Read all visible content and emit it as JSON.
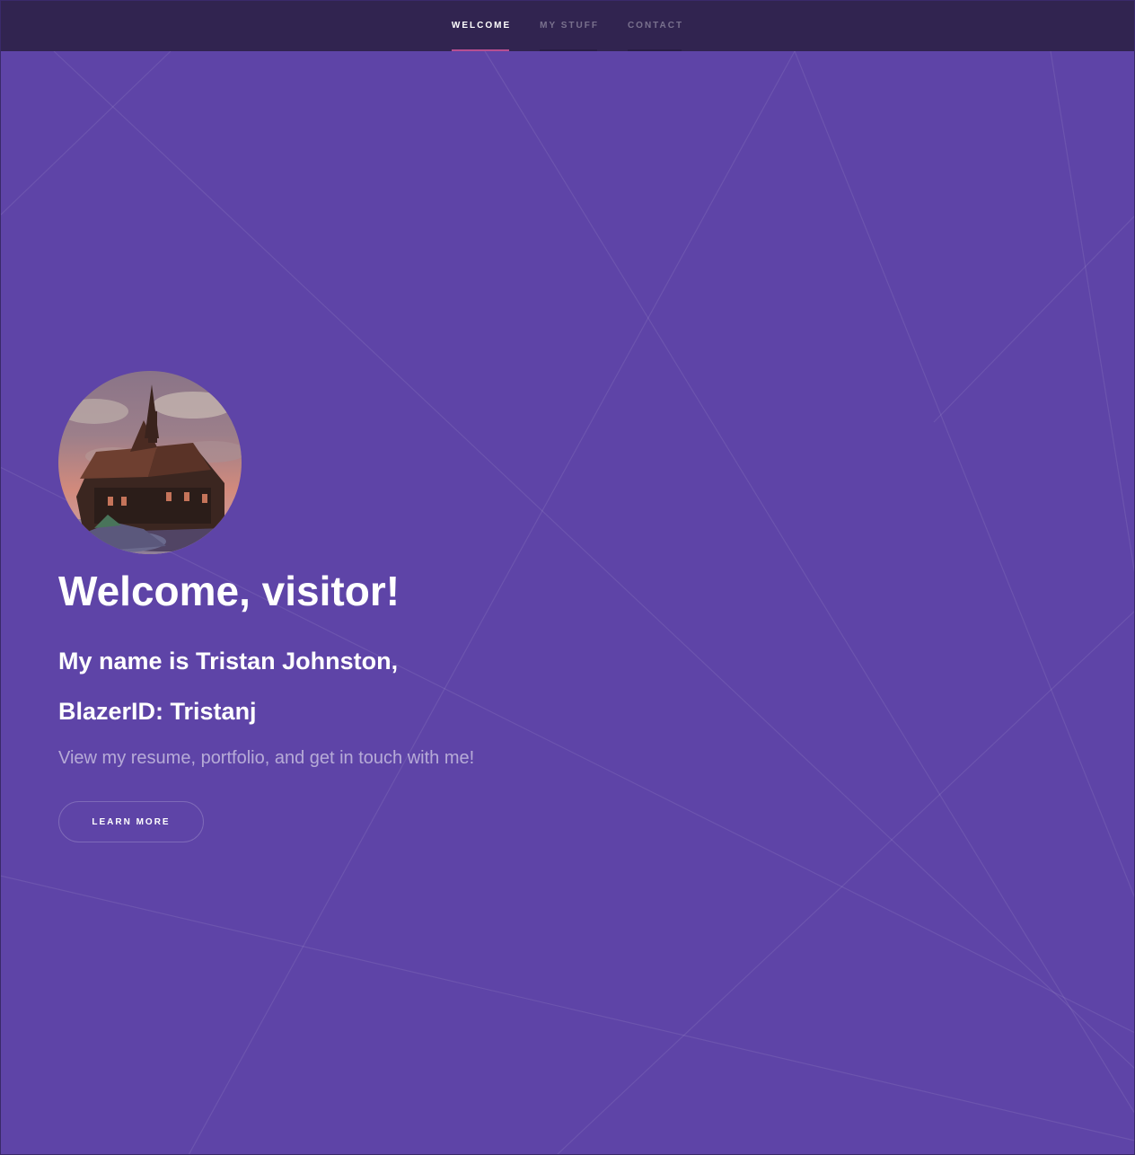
{
  "nav": {
    "items": [
      {
        "label": "WELCOME",
        "active": true
      },
      {
        "label": "MY STUFF",
        "active": false
      },
      {
        "label": "CONTACT",
        "active": false
      }
    ]
  },
  "hero": {
    "avatar_icon": "avatar-house-image",
    "title": "Welcome, visitor!",
    "name_line": "My name is Tristan Johnston,",
    "blazer_line": "BlazerID: Tristanj",
    "tagline": "View my resume, portfolio, and get in touch with me!",
    "button_label": "LEARN MORE"
  },
  "colors": {
    "background": "#5e44a7",
    "nav_background": "#312450",
    "nav_active_underline": "#b74e91",
    "text_primary": "#ffffff"
  }
}
